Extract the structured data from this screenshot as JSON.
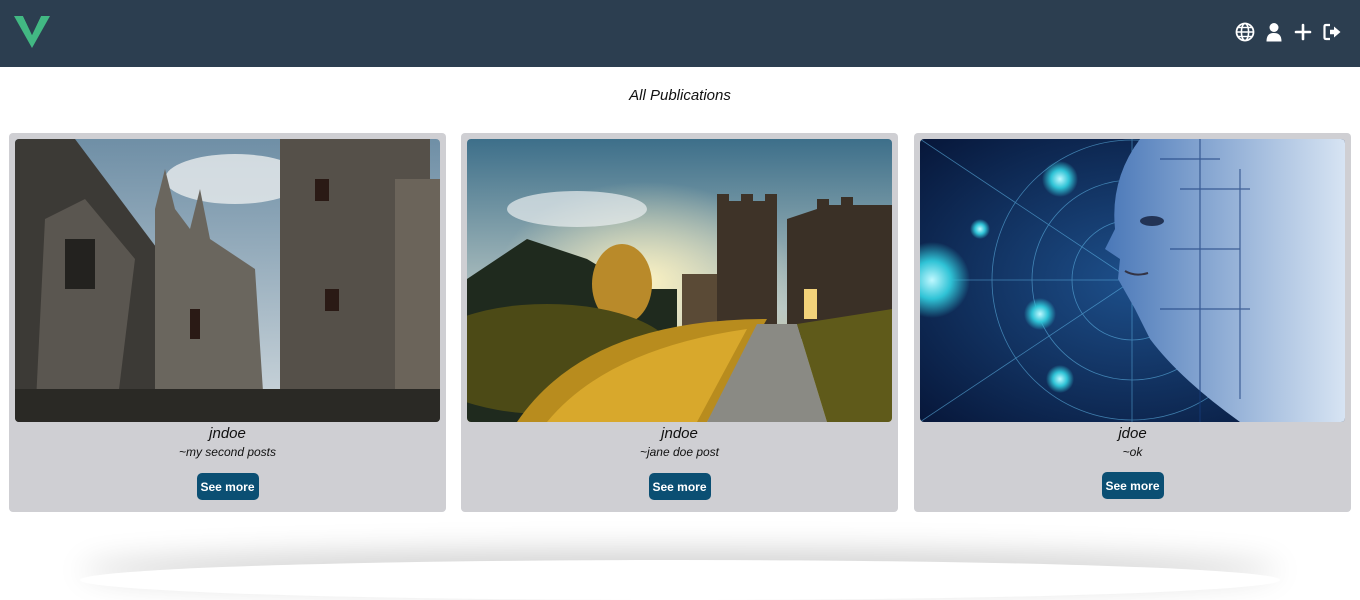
{
  "navbar": {
    "background": "#2c3e50",
    "logo_icon": "vue-logo-icon",
    "icons": [
      "globe-icon",
      "user-icon",
      "plus-icon",
      "logout-icon"
    ]
  },
  "main": {
    "title": "All Publications",
    "cards": [
      {
        "author": "jndoe",
        "description": "~my second posts",
        "button_label": "See more",
        "image": "gothic-castle-photo"
      },
      {
        "author": "jndoe",
        "description": "~jane doe post",
        "button_label": "See more",
        "image": "castle-sunset-path-photo"
      },
      {
        "author": "jdoe",
        "description": "~ok",
        "button_label": "See more",
        "image": "ai-circuit-face-photo"
      }
    ]
  },
  "colors": {
    "button": "#0b4f73",
    "card": "#cfcfd3",
    "logo_green": "#42b883"
  }
}
